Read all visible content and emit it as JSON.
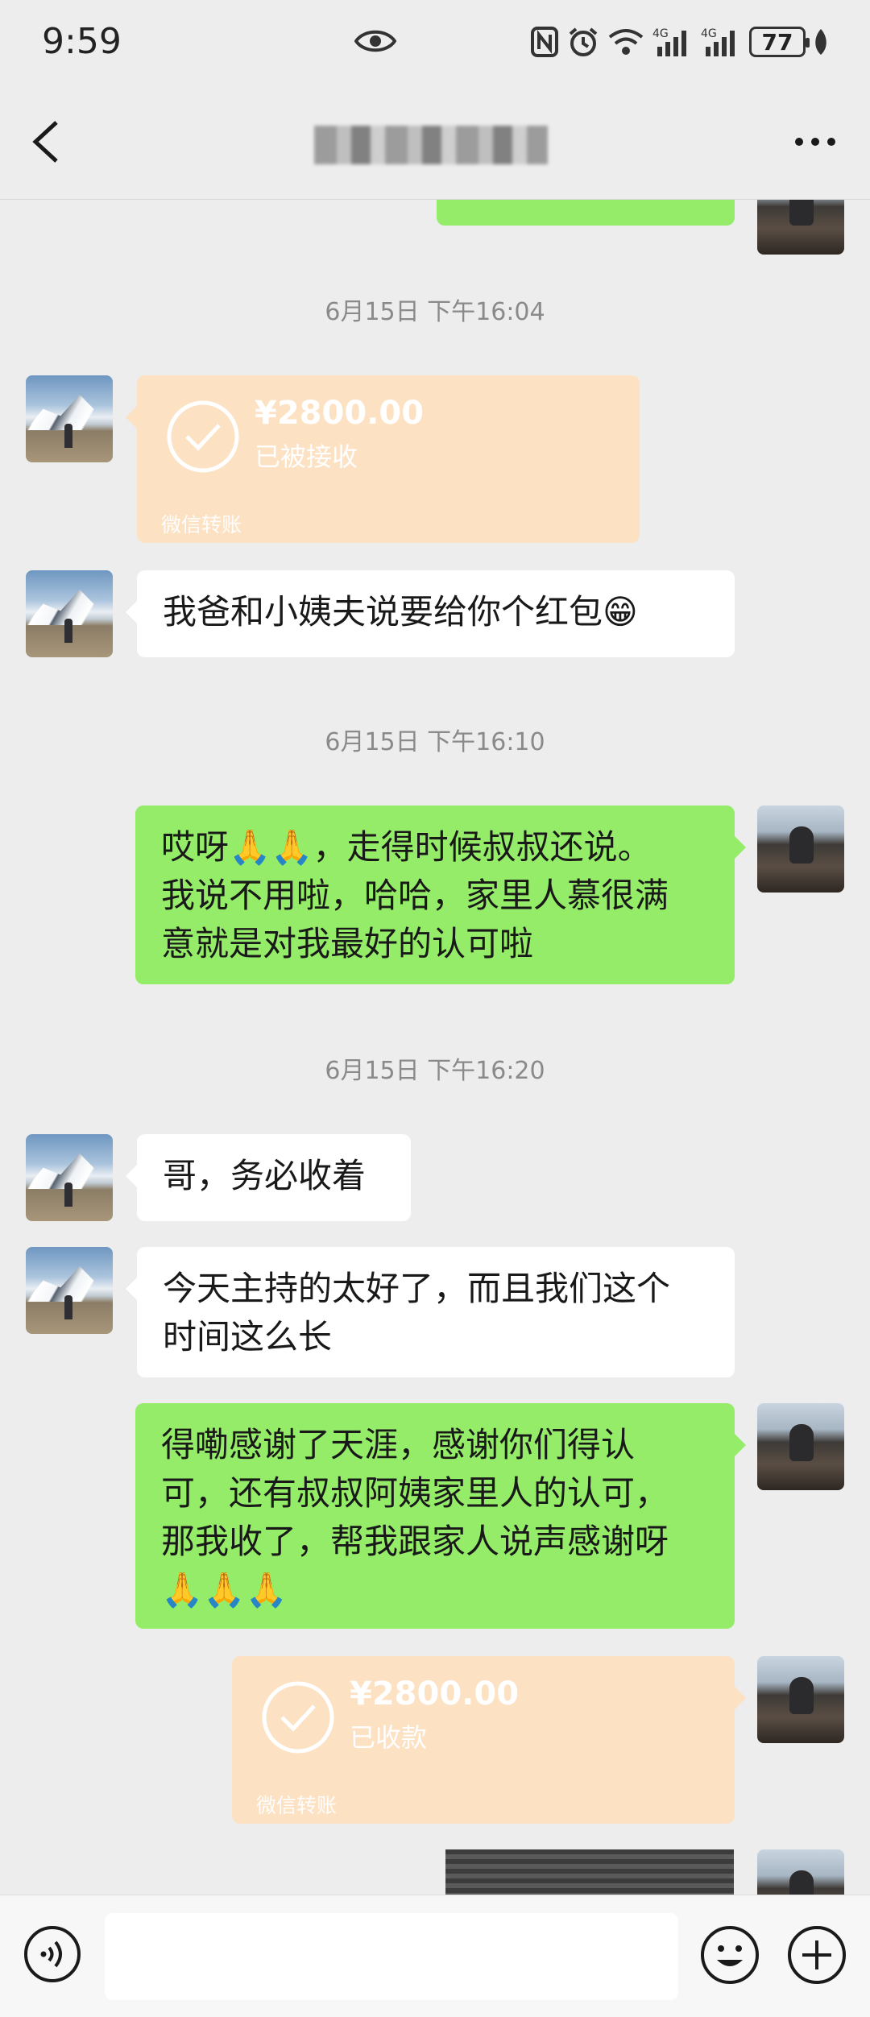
{
  "status_bar": {
    "time": "9:59",
    "battery": "77"
  },
  "nav": {
    "title": "",
    "back_icon": "chevron-left-icon",
    "more_icon": "more-dots-icon"
  },
  "colors": {
    "background": "#ededed",
    "bubble_sent": "#95ec69",
    "bubble_received": "#ffffff",
    "transfer_card": "#fde1c3"
  },
  "messages": {
    "ts1": "6月15日 下午16:04",
    "transfer1": {
      "amount": "¥2800.00",
      "status": "已被接收",
      "footer": "微信转账"
    },
    "m1": "我爸和小姨夫说要给你个红包😁",
    "ts2": "6月15日 下午16:10",
    "m2_line1": "哎呀🙏🙏，走得时候叔叔还说。",
    "m2_line2": "我说不用啦，哈哈，家里人慕很满",
    "m2_line3": "意就是对我最好的认可啦",
    "ts3": "6月15日 下午16:20",
    "m3": "哥，务必收着",
    "m4_line1": "今天主持的太好了，而且我们这个",
    "m4_line2": "时间这么长",
    "m5_line1": "得嘞感谢了天涯，感谢你们得认",
    "m5_line2": "可，还有叔叔阿姨家里人的认可，",
    "m5_line3": "那我收了，帮我跟家人说声感谢呀",
    "m5_line4": "🙏🙏🙏",
    "transfer2": {
      "amount": "¥2800.00",
      "status": "已收款",
      "footer": "微信转账"
    }
  },
  "input_bar": {
    "voice_icon": "voice-icon",
    "emoji_icon": "emoji-icon",
    "plus_icon": "plus-icon"
  }
}
